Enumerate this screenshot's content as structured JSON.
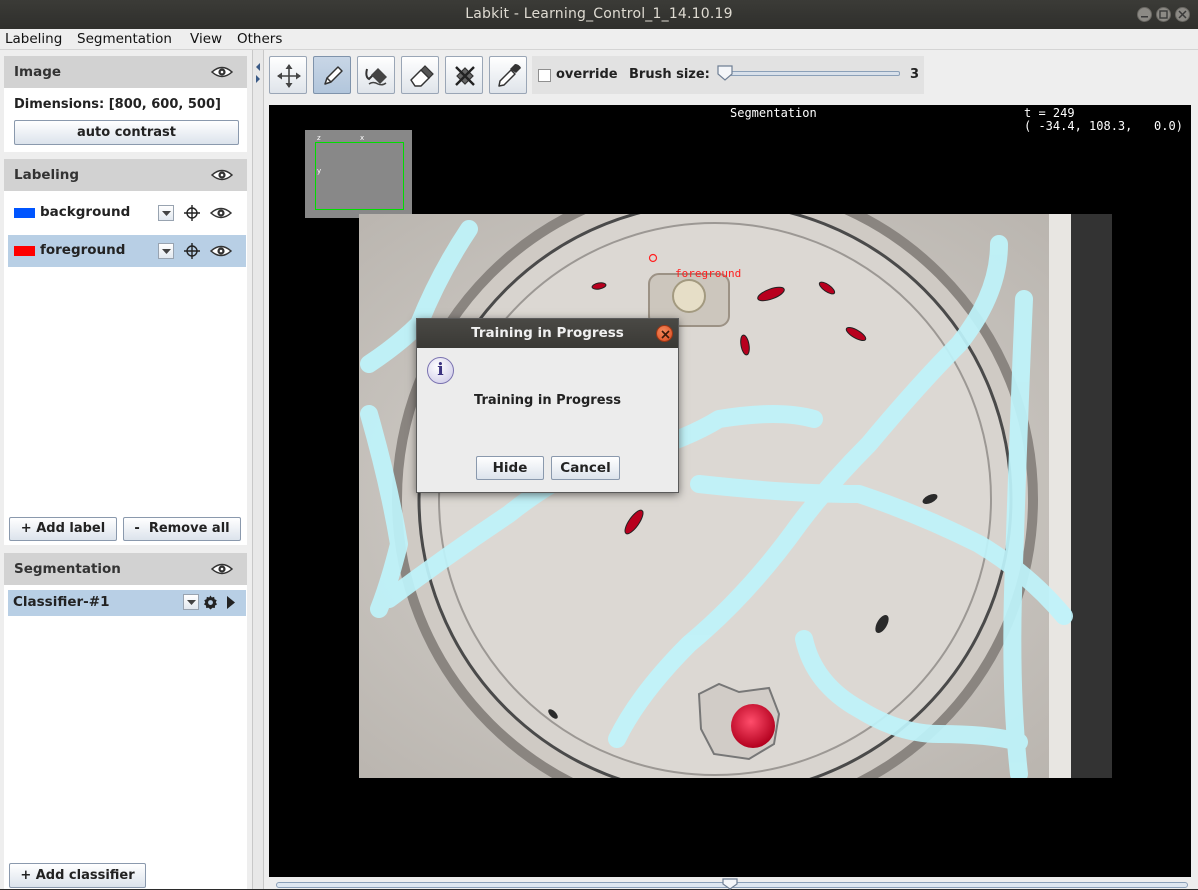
{
  "window": {
    "title": "Labkit - Learning_Control_1_14.10.19"
  },
  "menubar": {
    "items": [
      "Labeling",
      "Segmentation",
      "View",
      "Others"
    ]
  },
  "image_panel": {
    "header": "Image",
    "dimensions": "Dimensions: [800, 600, 500]",
    "auto_contrast_label": "auto contrast"
  },
  "labeling_panel": {
    "header": "Labeling",
    "labels": [
      {
        "name": "background",
        "color": "#0055ff",
        "selected": false
      },
      {
        "name": "foreground",
        "color": "#ff0000",
        "selected": true
      }
    ],
    "add_label": "Add label",
    "remove_all": "Remove all"
  },
  "segmentation_panel": {
    "header": "Segmentation",
    "classifier_name": "Classifier-#1",
    "add_classifier": "Add classifier"
  },
  "toolbar": {
    "tools": [
      "move-tool",
      "pencil-tool",
      "flood-fill-tool",
      "eraser-tool",
      "flood-erase-tool",
      "color-picker-tool"
    ],
    "active_tool": "pencil-tool",
    "override_label": "override",
    "override_checked": false,
    "brush_size_label": "Brush size:",
    "brush_size_value": "3"
  },
  "viewer": {
    "overlay_title": "Segmentation",
    "time_readout": "t = 249",
    "coord_readout": "( -34.4, 108.3,   0.0)",
    "minimap_axes": {
      "z": "z",
      "x": "x",
      "y": "y"
    },
    "cursor_label": "foreground",
    "time_slider_position": 0.5
  },
  "dialog": {
    "title": "Training in Progress",
    "message": "Training in Progress",
    "hide_label": "Hide",
    "cancel_label": "Cancel"
  },
  "colors": {
    "selected_row": "#b8cfe5",
    "panel_header": "#d2d2d2",
    "annotation_stroke": "#bff4fb",
    "foreground_label": "#ff0000",
    "background_label": "#0055ff"
  }
}
